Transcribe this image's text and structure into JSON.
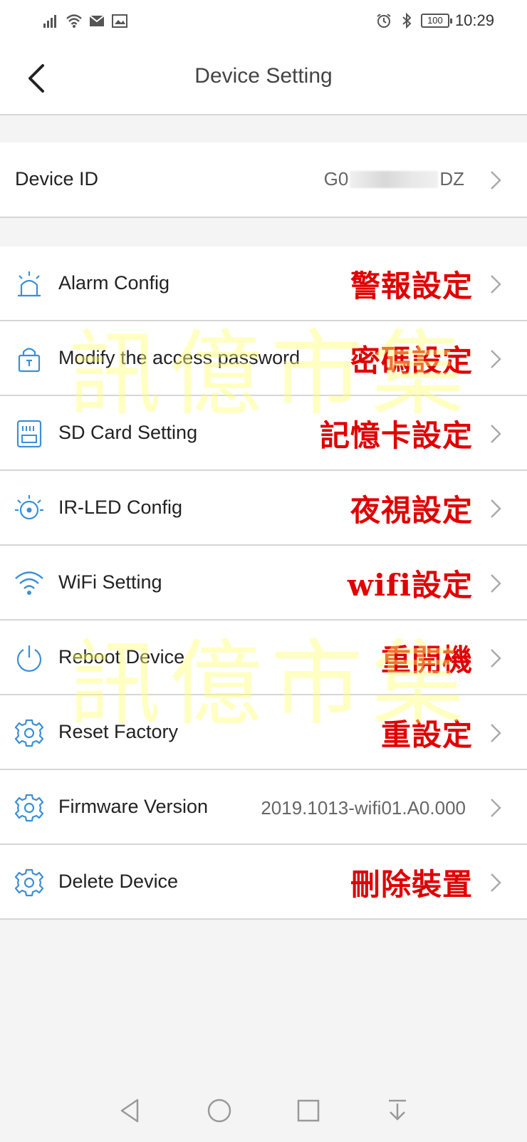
{
  "status_bar": {
    "time": "10:29",
    "battery": "100",
    "left_icons": [
      "signal-icon",
      "wifi-icon",
      "mail-icon",
      "gallery-icon"
    ],
    "right_icons": [
      "alarm-clock-icon",
      "bluetooth-icon",
      "battery-icon"
    ]
  },
  "header": {
    "title": "Device Setting",
    "back_icon": "chevron-left-icon"
  },
  "device_id": {
    "label": "Device ID",
    "value_prefix": "G0",
    "value_suffix": "DZ"
  },
  "settings": [
    {
      "label": "Alarm Config",
      "icon": "alarm-icon",
      "annotation": "警報設定",
      "value": ""
    },
    {
      "label": "Modify the access password",
      "icon": "lock-icon",
      "annotation": "密碼設定",
      "value": ""
    },
    {
      "label": "SD Card Setting",
      "icon": "sd-card-icon",
      "annotation": "記憶卡設定",
      "value": ""
    },
    {
      "label": "IR-LED Config",
      "icon": "ir-led-icon",
      "annotation": "夜視設定",
      "value": ""
    },
    {
      "label": "WiFi Setting",
      "icon": "wifi-icon",
      "annotation": "wifi設定",
      "value": ""
    },
    {
      "label": "Reboot Device",
      "icon": "power-icon",
      "annotation": "重開機",
      "value": ""
    },
    {
      "label": "Reset Factory",
      "icon": "gear-icon",
      "annotation": "重設定",
      "value": ""
    },
    {
      "label": "Firmware Version",
      "icon": "gear-icon",
      "annotation": "",
      "value": "2019.1013-wifi01.A0.000"
    },
    {
      "label": "Delete Device",
      "icon": "gear-icon",
      "annotation": "刪除裝置",
      "value": ""
    }
  ],
  "watermark": [
    "訊億市集",
    "訊億市集"
  ],
  "nav_bar": {
    "buttons": [
      "back-triangle-icon",
      "home-circle-icon",
      "recents-square-icon",
      "notification-pull-icon"
    ]
  },
  "colors": {
    "accent_blue": "#3b8fd6",
    "annotation_red": "#e00000",
    "divider": "#d6d6d6",
    "background": "#f4f4f4"
  }
}
